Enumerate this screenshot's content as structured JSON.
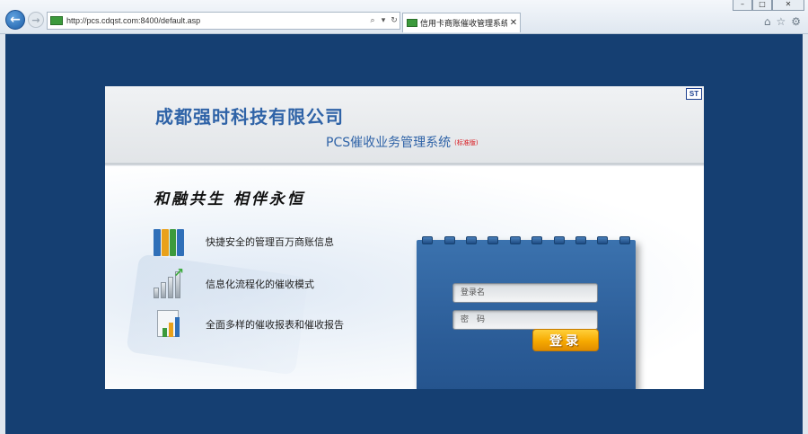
{
  "browser": {
    "url": "http://pcs.cdqst.com:8400/default.asp",
    "tab_title": "信用卡商账催收管理系统-...",
    "site_icon_text": "OK"
  },
  "header": {
    "company": "成都强时科技有限公司",
    "system_name": "PCS催收业务管理系统",
    "edition": "(标准版)",
    "logo_text": "ST"
  },
  "slogan": "和融共生 相伴永恒",
  "features": [
    {
      "text": "快捷安全的管理百万商账信息"
    },
    {
      "text": "信息化流程化的催收模式"
    },
    {
      "text": "全面多样的催收报表和催收报告"
    }
  ],
  "login": {
    "username_placeholder": "登录名",
    "password_placeholder": "密　码",
    "submit_label": "登录"
  },
  "colors": {
    "page_bg": "#153f72",
    "accent_blue": "#2f63a7",
    "login_panel": "#2b5c97",
    "button_gold": "#f6a900",
    "edition_red": "#d8161b"
  }
}
